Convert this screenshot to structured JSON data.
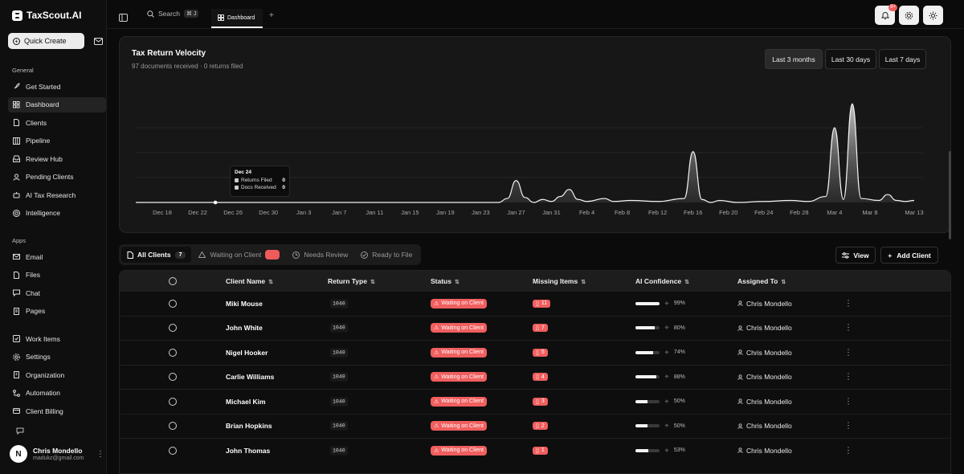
{
  "app": {
    "name": "TaxScout.AI"
  },
  "sidebar": {
    "quick_create": "Quick Create",
    "general_label": "General",
    "general": [
      {
        "label": "Get Started",
        "icon": "rocket-icon"
      },
      {
        "label": "Dashboard",
        "icon": "dashboard-icon",
        "active": true
      },
      {
        "label": "Clients",
        "icon": "file-icon"
      },
      {
        "label": "Pipeline",
        "icon": "columns-icon"
      },
      {
        "label": "Review Hub",
        "icon": "inbox-icon"
      },
      {
        "label": "Pending Clients",
        "icon": "user-icon"
      },
      {
        "label": "AI Tax Research",
        "icon": "bot-icon"
      },
      {
        "label": "Intelligence",
        "icon": "target-icon"
      }
    ],
    "apps_label": "Apps",
    "apps": [
      {
        "label": "Email",
        "icon": "mail-icon"
      },
      {
        "label": "Files",
        "icon": "file-icon"
      },
      {
        "label": "Chat",
        "icon": "chat-icon"
      },
      {
        "label": "Pages",
        "icon": "page-icon"
      }
    ],
    "other": [
      {
        "label": "Work Items",
        "icon": "check-icon"
      },
      {
        "label": "Settings",
        "icon": "gear-icon"
      },
      {
        "label": "Organization",
        "icon": "building-icon"
      },
      {
        "label": "Automation",
        "icon": "flow-icon"
      },
      {
        "label": "Client Billing",
        "icon": "card-icon"
      }
    ],
    "user": {
      "initial": "N",
      "name": "Chris Mondello",
      "email": "madukz@gmail.com"
    }
  },
  "topbar": {
    "search": "Search",
    "shortcut": "⌘ J",
    "tab": "Dashboard",
    "notif_badge": "9+"
  },
  "card": {
    "title": "Tax Return Velocity",
    "subtitle": "97 documents received · 0 returns filed",
    "ranges": [
      "Last 3 months",
      "Last 30 days",
      "Last 7 days"
    ],
    "active_range": "Last 3 months",
    "tooltip": {
      "date": "Dec 24",
      "rows": [
        {
          "label": "Returns Filed",
          "value": "0"
        },
        {
          "label": "Docs Received",
          "value": "0"
        }
      ]
    }
  },
  "chart_data": {
    "type": "area",
    "title": "Tax Return Velocity",
    "x_ticks": [
      "Dec 18",
      "Dec 22",
      "Dec 26",
      "Dec 30",
      "Jan 3",
      "Jan 7",
      "Jan 11",
      "Jan 15",
      "Jan 19",
      "Jan 23",
      "Jan 27",
      "Jan 31",
      "Feb 4",
      "Feb 8",
      "Feb 12",
      "Feb 16",
      "Feb 20",
      "Feb 24",
      "Feb 28",
      "Mar 4",
      "Mar 8",
      "Mar 13"
    ],
    "series": [
      {
        "name": "Docs Received",
        "points": [
          [
            "Dec 15",
            0
          ],
          [
            "Jan 25",
            0
          ],
          [
            "Jan 26",
            0.4
          ],
          [
            "Jan 27",
            2.2
          ],
          [
            "Jan 28",
            0.5
          ],
          [
            "Jan 29",
            0
          ],
          [
            "Jan 30",
            0.3
          ],
          [
            "Jan 31",
            0.1
          ],
          [
            "Feb 1",
            0.6
          ],
          [
            "Feb 2",
            1.3
          ],
          [
            "Feb 3",
            0.3
          ],
          [
            "Feb 4",
            0.1
          ],
          [
            "Feb 6",
            0.4
          ],
          [
            "Feb 7",
            0.1
          ],
          [
            "Feb 9",
            0.2
          ],
          [
            "Feb 12",
            0.1
          ],
          [
            "Feb 15",
            0.4
          ],
          [
            "Feb 16",
            5.1
          ],
          [
            "Feb 17",
            0.3
          ],
          [
            "Feb 18",
            0
          ],
          [
            "Feb 19",
            0.2
          ],
          [
            "Feb 21",
            0
          ],
          [
            "Feb 24",
            0.1
          ],
          [
            "Feb 27",
            0.2
          ],
          [
            "Mar 1",
            0.1
          ],
          [
            "Mar 3",
            0.6
          ],
          [
            "Mar 4",
            7.5
          ],
          [
            "Mar 5",
            0.3
          ],
          [
            "Mar 6",
            9.9
          ],
          [
            "Mar 7",
            0.4
          ],
          [
            "Mar 9",
            0.2
          ],
          [
            "Mar 10",
            0.8
          ],
          [
            "Mar 11",
            0.2
          ],
          [
            "Mar 12",
            0.1
          ],
          [
            "Mar 13",
            0.2
          ]
        ]
      }
    ],
    "grid": true
  },
  "filters": [
    {
      "label": "All Clients",
      "count": "7",
      "active": true
    },
    {
      "label": "Waiting on Client",
      "count": "",
      "red": true
    },
    {
      "label": "Needs Review"
    },
    {
      "label": "Ready to File"
    }
  ],
  "actions": {
    "view": "View",
    "add": "Add Client"
  },
  "table": {
    "headers": [
      "Client Name",
      "Return Type",
      "Status",
      "Missing Items",
      "AI Confidence",
      "Assigned To"
    ],
    "rows": [
      {
        "name": "Miki Mouse",
        "type": "1040",
        "status": "Waiting on Client",
        "missing": "11",
        "conf": 99,
        "conf_label": "99%",
        "assignee": "Chris Mondello"
      },
      {
        "name": "John White",
        "type": "1040",
        "status": "Waiting on Client",
        "missing": "7",
        "conf": 80,
        "conf_label": "80%",
        "assignee": "Chris Mondello"
      },
      {
        "name": "Nigel Hooker",
        "type": "1040",
        "status": "Waiting on Client",
        "missing": "5",
        "conf": 74,
        "conf_label": "74%",
        "assignee": "Chris Mondello"
      },
      {
        "name": "Carlie Williams",
        "type": "1040",
        "status": "Waiting on Client",
        "missing": "4",
        "conf": 88,
        "conf_label": "88%",
        "assignee": "Chris Mondello"
      },
      {
        "name": "Michael Kim",
        "type": "1040",
        "status": "Waiting on Client",
        "missing": "3",
        "conf": 50,
        "conf_label": "50%",
        "assignee": "Chris Mondello"
      },
      {
        "name": "Brian Hopkins",
        "type": "1040",
        "status": "Waiting on Client",
        "missing": "2",
        "conf": 50,
        "conf_label": "50%",
        "assignee": "Chris Mondello"
      },
      {
        "name": "John Thomas",
        "type": "1040",
        "status": "Waiting on Client",
        "missing": "1",
        "conf": 53,
        "conf_label": "53%",
        "assignee": "Chris Mondello"
      }
    ]
  }
}
